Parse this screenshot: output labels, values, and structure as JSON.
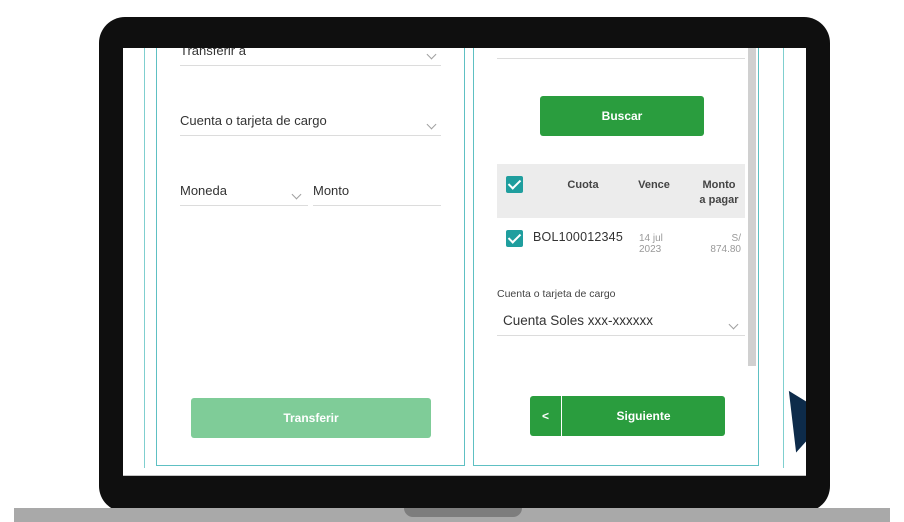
{
  "left_form": {
    "transfer_to_label": "Transferir a",
    "account_label": "Cuenta o tarjeta de cargo",
    "currency_label": "Moneda",
    "amount_label": "Monto",
    "transfer_button": "Transferir"
  },
  "right_form": {
    "search_button": "Buscar",
    "table": {
      "headers": [
        "Cuota",
        "Vence",
        "Monto a pagar"
      ],
      "header_lines": {
        "amount_line1": "Monto",
        "amount_line2": "a pagar"
      },
      "rows": [
        {
          "checked": true,
          "cuota": "BOL100012345",
          "vence_line1": "14 jul",
          "vence_line2": "2023",
          "monto_line1": "S/",
          "monto_line2": "874.80"
        }
      ]
    },
    "charge_label": "Cuenta o tarjeta de cargo",
    "charge_value": "Cuenta Soles xxx-xxxxxx",
    "back_symbol": "<",
    "next_button": "Siguiente"
  },
  "colors": {
    "green": "#2a9d3e",
    "green_disabled": "#7fcc98",
    "teal": "#1f9e9e",
    "cursor": "#0d2b4a"
  }
}
